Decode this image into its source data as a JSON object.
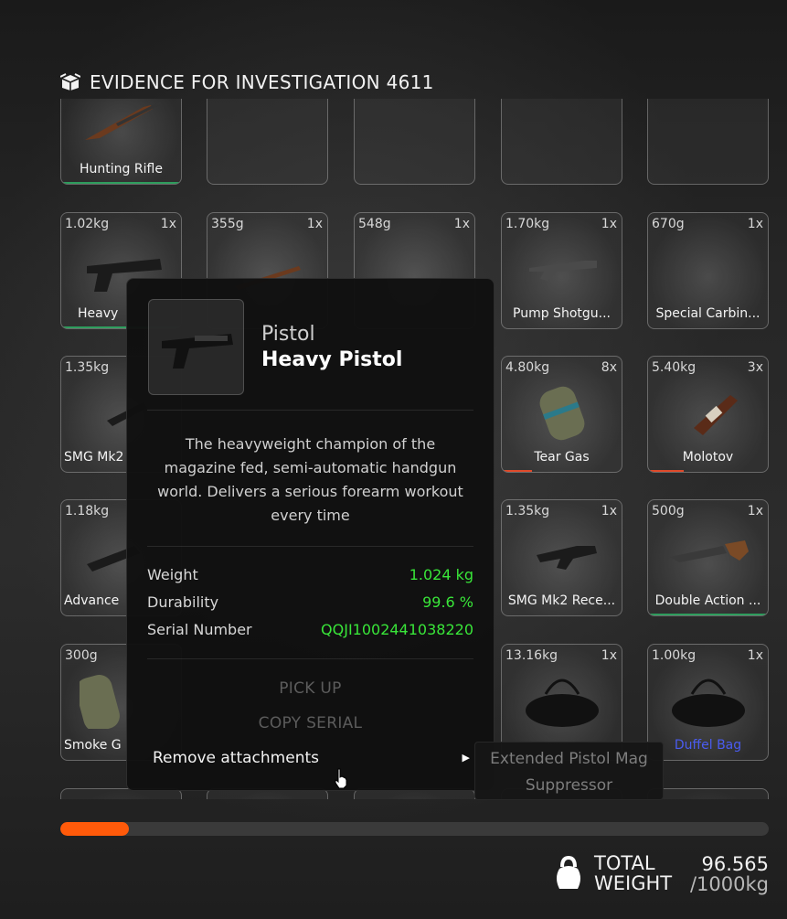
{
  "header": {
    "title": "EVIDENCE FOR INVESTIGATION 4611",
    "icon": "box-icon"
  },
  "slots_row0": [
    {
      "name": "Hunting Rifle"
    }
  ],
  "slots_row1": [
    {
      "weight": "1.02kg",
      "count": "1x",
      "name": "Heavy"
    },
    {
      "weight": "355g",
      "count": "1x"
    },
    {
      "weight": "548g",
      "count": "1x"
    },
    {
      "weight": "1.70kg",
      "count": "1x",
      "name": "Pump Shotgu..."
    },
    {
      "weight": "670g",
      "count": "1x",
      "name": "Special Carbin..."
    }
  ],
  "slots_row2": [
    {
      "weight": "1.35kg",
      "name": "SMG Mk2"
    },
    {
      "weight": "4.80kg",
      "count": "8x",
      "name": "Tear Gas"
    },
    {
      "weight": "5.40kg",
      "count": "3x",
      "name": "Molotov"
    }
  ],
  "slots_row3": [
    {
      "weight": "1.18kg",
      "name": "Advance"
    },
    {
      "weight": "1.35kg",
      "count": "1x",
      "name": "SMG Mk2 Rece..."
    },
    {
      "weight": "500g",
      "count": "1x",
      "name": "Double Action ..."
    }
  ],
  "slots_row4": [
    {
      "weight": "300g",
      "name": "Smoke G"
    },
    {
      "weight": "13.16kg",
      "count": "1x"
    },
    {
      "weight": "1.00kg",
      "count": "1x",
      "name": "Duffel Bag"
    }
  ],
  "tooltip": {
    "category": "Pistol",
    "name": "Heavy Pistol",
    "description": "The heavyweight champion of the magazine fed, semi-automatic handgun world. Delivers a serious forearm workout every time",
    "stats": [
      {
        "label": "Weight",
        "value": "1.024 kg"
      },
      {
        "label": "Durability",
        "value": "99.6 %"
      },
      {
        "label": "Serial Number",
        "value": "QQJI1002441038220"
      }
    ],
    "actions": {
      "pick_up": "PICK UP",
      "copy_serial": "COPY SERIAL",
      "remove_attachments": "Remove attachments"
    }
  },
  "submenu": {
    "items": [
      "Extended Pistol Mag",
      "Suppressor"
    ]
  },
  "footer": {
    "progress_fraction": 0.0966,
    "total_label_1": "TOTAL",
    "total_label_2": "WEIGHT",
    "total_value": "96.565",
    "max_value": "/1000kg"
  },
  "colors": {
    "accent": "#ff5a0a",
    "stat_value": "#39e639",
    "durability_green": "#2ecc71",
    "durability_red": "#e04a2a"
  }
}
